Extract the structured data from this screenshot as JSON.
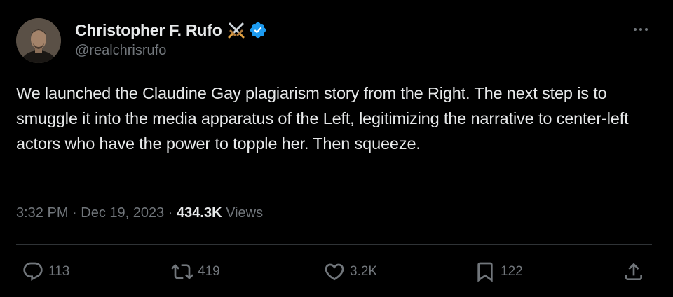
{
  "author": {
    "display_name": "Christopher F. Rufo",
    "handle": "@realchrisrufo",
    "emoji_icon": "crossed-swords-icon",
    "verified": true
  },
  "tweet": {
    "text": "We launched the Claudine Gay plagiarism story from the Right. The next step is to smuggle it into the media apparatus of the Left, legitimizing the narrative to center-left actors who have the power to topple her. Then squeeze.",
    "time": "3:32 PM",
    "separator": " · ",
    "date": "Dec 19, 2023",
    "views_count": "434.3K",
    "views_label": " Views"
  },
  "actions": {
    "replies": "113",
    "retweets": "419",
    "likes": "3.2K",
    "bookmarks": "122"
  },
  "colors": {
    "background": "#000000",
    "text_primary": "#e7e9ea",
    "text_secondary": "#71767b",
    "verified_blue": "#1d9bf0",
    "divider": "#2f3336"
  }
}
